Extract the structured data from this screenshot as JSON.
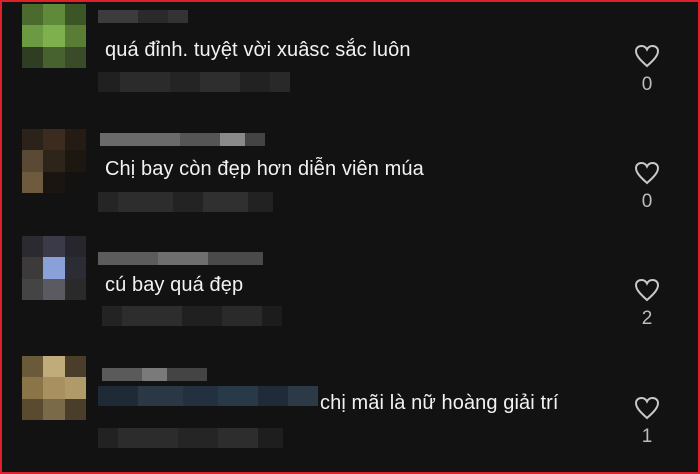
{
  "comments": [
    {
      "text": "quá đỉnh. tuyệt vời xuâsc sắc luôn",
      "likes": "0"
    },
    {
      "text": "Chị bay còn đẹp hơn diễn viên múa",
      "likes": "0"
    },
    {
      "text": "cú bay quá đẹp",
      "likes": "2"
    },
    {
      "text": "chị mãi là nữ hoàng giải trí",
      "likes": "1"
    }
  ],
  "colors": {
    "background": "#121212",
    "text": "#f2f2f2",
    "muted": "#bdbdbd",
    "border": "#e0202a"
  },
  "icons": [
    "heart-icon"
  ]
}
